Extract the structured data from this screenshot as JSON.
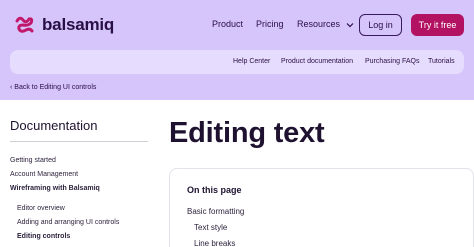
{
  "header": {
    "brand": "balsamiq",
    "nav": {
      "product": "Product",
      "pricing": "Pricing",
      "resources": "Resources"
    },
    "login_label": "Log in",
    "try_label": "Try it free"
  },
  "subnav": {
    "items": [
      "Help Center",
      "Product documentation",
      "Purchasing FAQs",
      "Tutorials"
    ]
  },
  "back_link": "‹ Back to Editing UI controls",
  "sidebar": {
    "title": "Documentation",
    "items": [
      "Getting started",
      "Account Management",
      "Wireframing with Balsamiq",
      "Editor overview",
      "Adding and arranging UI controls",
      "Editing controls"
    ]
  },
  "main": {
    "title": "Editing text",
    "toc": {
      "heading": "On this page",
      "items": [
        "Basic formatting",
        "Text style",
        "Line breaks"
      ]
    }
  },
  "colors": {
    "header_bg": "#d6c5fb",
    "subnav_bg": "#e6dcfd",
    "accent": "#b31263",
    "text_dark": "#2a0f45"
  }
}
